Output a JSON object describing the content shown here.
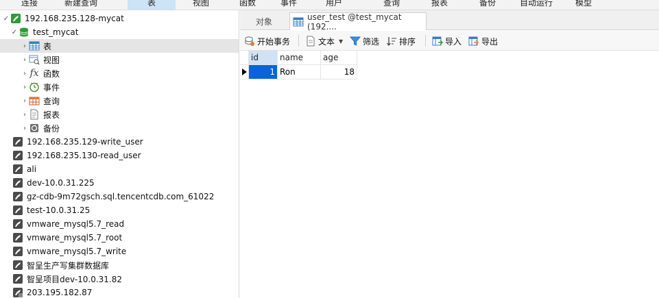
{
  "toolbar": {
    "items": [
      {
        "label": "连接"
      },
      {
        "label": "新建查询"
      },
      {
        "label": "表"
      },
      {
        "label": "视图"
      },
      {
        "label": "函数"
      },
      {
        "label": "事件"
      },
      {
        "label": "用户"
      },
      {
        "label": "查询"
      },
      {
        "label": "报表"
      },
      {
        "label": "备份"
      },
      {
        "label": "自动运行"
      },
      {
        "label": "模型"
      }
    ]
  },
  "nav": {
    "connection": {
      "label": "192.168.235.128-mycat"
    },
    "database": {
      "label": "test_mycat"
    },
    "objects": [
      {
        "label": "表",
        "icon": "table-icon"
      },
      {
        "label": "视图",
        "icon": "view-icon"
      },
      {
        "label": "函数",
        "icon": "function-icon"
      },
      {
        "label": "事件",
        "icon": "event-icon"
      },
      {
        "label": "查询",
        "icon": "query-icon"
      },
      {
        "label": "报表",
        "icon": "report-icon"
      },
      {
        "label": "备份",
        "icon": "backup-icon"
      }
    ],
    "connections": [
      {
        "label": "192.168.235.129-write_user"
      },
      {
        "label": "192.168.235.130-read_user"
      },
      {
        "label": "ali"
      },
      {
        "label": "dev-10.0.31.225"
      },
      {
        "label": "gz-cdb-9m72gsch.sql.tencentcdb.com_61022"
      },
      {
        "label": "test-10.0.31.25"
      },
      {
        "label": "vmware_mysql5.7_read"
      },
      {
        "label": "vmware_mysql5.7_root"
      },
      {
        "label": "vmware_mysql5.7_write"
      },
      {
        "label": "智呈生产写集群数据库"
      },
      {
        "label": "智呈项目dev-10.0.31.82"
      },
      {
        "label": "203.195.182.87"
      }
    ]
  },
  "tabs": {
    "objects": "对象",
    "active": "user_test @test_mycat (192...."
  },
  "actions": {
    "begin_transaction": "开始事务",
    "text": "文本",
    "filter": "筛选",
    "sort": "排序",
    "import": "导入",
    "export": "导出"
  },
  "grid": {
    "columns": [
      "id",
      "name",
      "age"
    ],
    "rows": [
      {
        "id": "1",
        "name": "Ron",
        "age": "18"
      }
    ]
  },
  "colors": {
    "selection": "#0a64d8",
    "header_sorted": "#cfe3f5",
    "mysql_icon": "#4a4a4a",
    "db_icon": "#2e9b3a"
  }
}
